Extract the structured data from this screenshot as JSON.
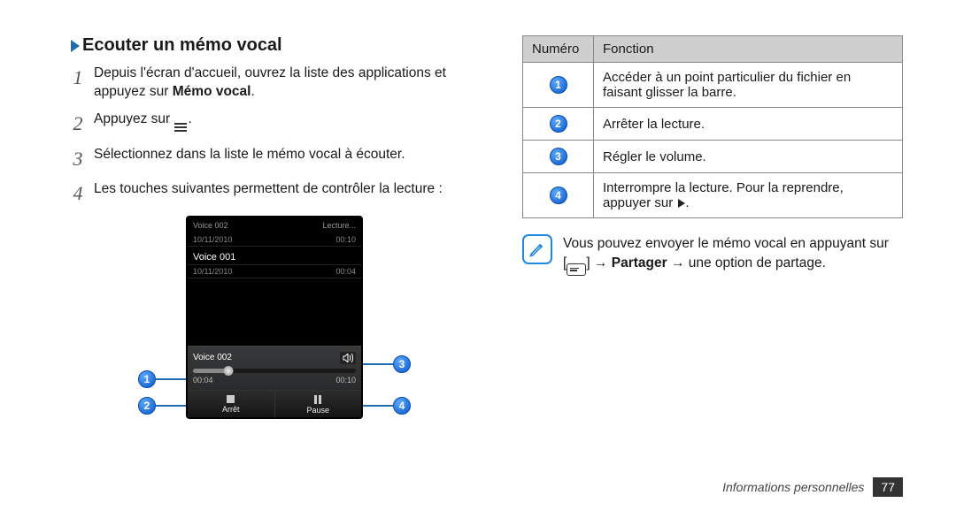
{
  "section_title": "Ecouter un mémo vocal",
  "steps": [
    {
      "num": "1",
      "text_before": "Depuis l'écran d'accueil, ouvrez la liste des applications et appuyez sur ",
      "bold": "Mémo vocal",
      "text_after": "."
    },
    {
      "num": "2",
      "text_before": "Appuyez sur ",
      "has_list_icon": true,
      "text_after": "."
    },
    {
      "num": "3",
      "text_before": "Sélectionnez dans la liste le mémo vocal à écouter."
    },
    {
      "num": "4",
      "text_before": "Les touches suivantes permettent de contrôler la lecture :"
    }
  ],
  "phone": {
    "header_title": "Voice 002",
    "header_right": "Lecture...",
    "header_date": "10/11/2010",
    "header_dur": "00:10",
    "list_item_title": "Voice 001",
    "list_item_date": "10/11/2010",
    "list_item_dur": "00:04",
    "now_title": "Voice 002",
    "time_elapsed": "00:04",
    "time_total": "00:10",
    "btn_stop": "Arrêt",
    "btn_pause": "Pause"
  },
  "callouts": {
    "c1": "1",
    "c2": "2",
    "c3": "3",
    "c4": "4"
  },
  "table": {
    "head_num": "Numéro",
    "head_func": "Fonction",
    "rows": [
      {
        "n": "1",
        "f": "Accéder à un point particulier du fichier en faisant glisser la barre."
      },
      {
        "n": "2",
        "f": "Arrêter la lecture."
      },
      {
        "n": "3",
        "f": "Régler le volume."
      },
      {
        "n": "4",
        "f_before": "Interrompre la lecture. Pour la reprendre, appuyer sur ",
        "f_play_icon": true,
        "f_after": "."
      }
    ]
  },
  "note": {
    "line1": "Vous pouvez envoyer le mémo vocal en appuyant sur",
    "line2_before": "[",
    "line2_after": "] → ",
    "bold": "Partager",
    "line2_end": " → une option de partage."
  },
  "footer": {
    "section": "Informations personnelles",
    "page": "77"
  }
}
